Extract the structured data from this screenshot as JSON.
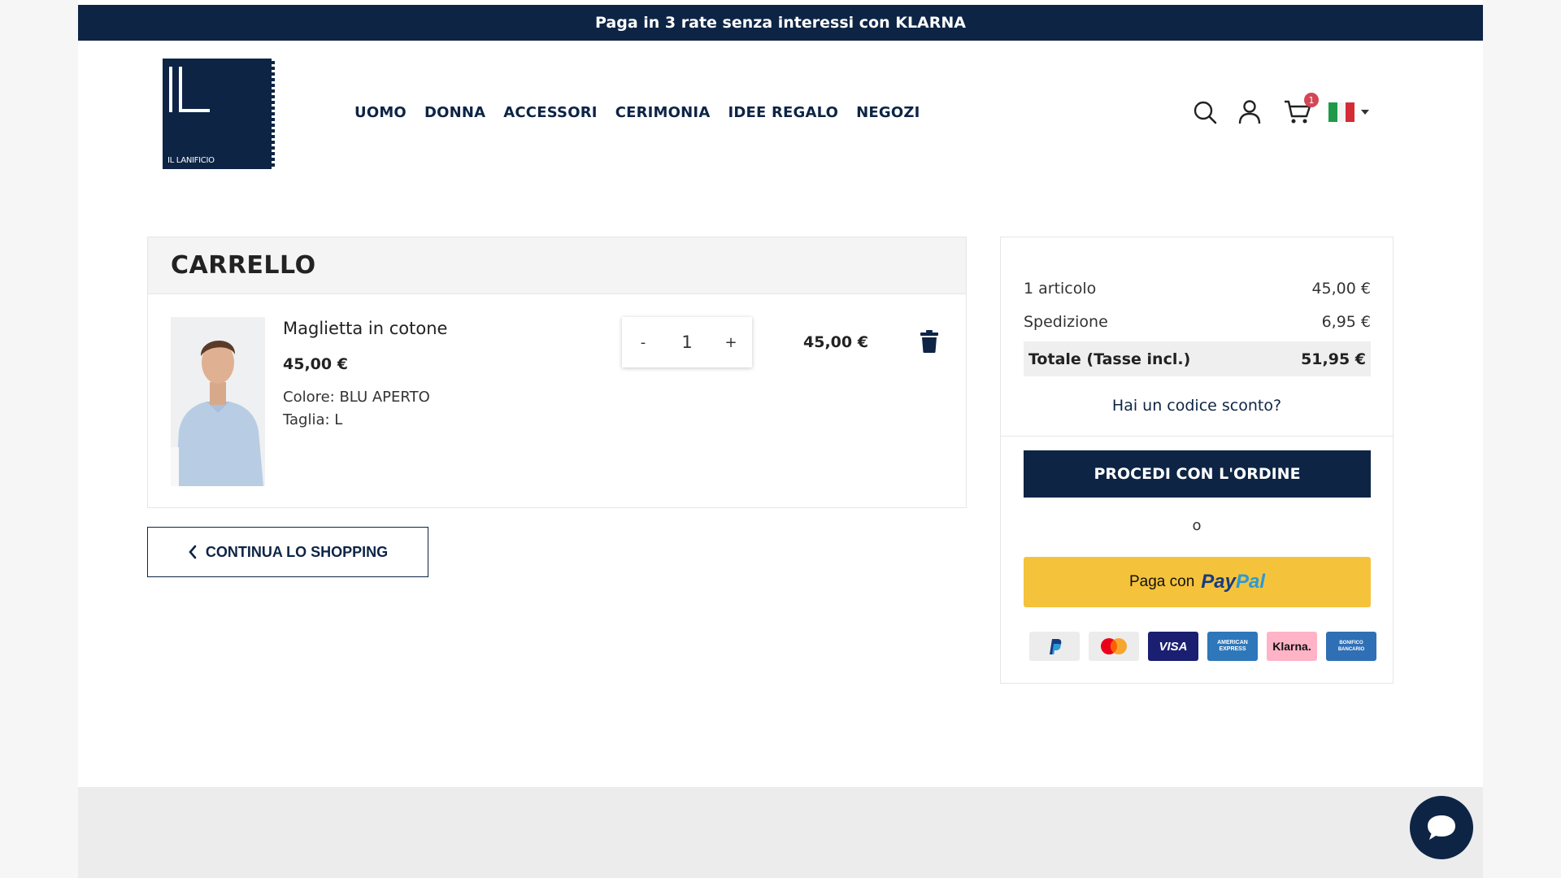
{
  "promo": {
    "text": "Paga in 3 rate senza interessi con KLARNA"
  },
  "logo": {
    "text": "IL LANIFICIO"
  },
  "nav": {
    "items": [
      "UOMO",
      "DONNA",
      "ACCESSORI",
      "CERIMONIA",
      "IDEE REGALO",
      "NEGOZI"
    ]
  },
  "header": {
    "cart_count": "1",
    "icons": [
      "search-icon",
      "user-icon",
      "cart-icon",
      "italy-flag-icon",
      "chevron-down-icon"
    ]
  },
  "cart": {
    "title": "CARRELLO",
    "item": {
      "name": "Maglietta in cotone",
      "price": "45,00 €",
      "color": "Colore: BLU APERTO",
      "size": "Taglia: L",
      "qty_minus": "-",
      "quantity": "1",
      "qty_plus": "+",
      "line_total": "45,00 €"
    }
  },
  "continue_label": "CONTINUA LO SHOPPING",
  "summary": {
    "items_label": "1 articolo",
    "items_value": "45,00 €",
    "shipping_label": "Spedizione",
    "shipping_value": "6,95 €",
    "total_label": "Totale (Tasse incl.)",
    "total_value": "51,95 €",
    "discount_link": "Hai un codice sconto?",
    "proceed_label": "PROCEDI CON L'ORDINE",
    "or_text": "o",
    "paypal_prefix": "Paga con",
    "paypal_logo_pay": "Pay",
    "paypal_logo_pal": "Pal",
    "payment_methods": {
      "mastercard": "",
      "visa": "VISA",
      "amex_line1": "AMERICAN",
      "amex_line2": "EXPRESS",
      "klarna": "Klarna.",
      "bonifico_line1": "BONIFICO",
      "bonifico_line2": "BANCARIO"
    }
  },
  "colors": {
    "navy": "#0d2445",
    "paypal_yellow": "#f5c33b",
    "badge_red": "#d34755"
  }
}
